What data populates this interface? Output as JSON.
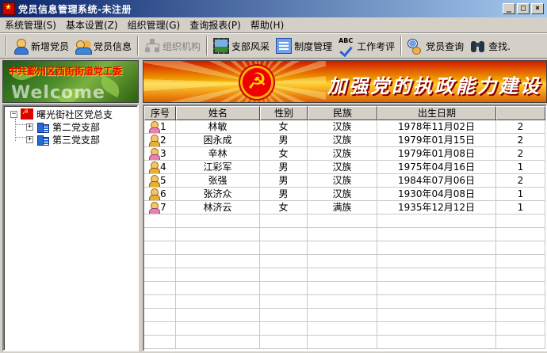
{
  "window": {
    "title": "党员信息管理系统-未注册",
    "buttons": {
      "minimize": "_",
      "maximize": "□",
      "close": "×"
    }
  },
  "menu": [
    {
      "label": "系统管理(S)"
    },
    {
      "label": "基本设置(Z)"
    },
    {
      "label": "组织管理(G)"
    },
    {
      "label": "查询报表(P)"
    },
    {
      "label": "帮助(H)"
    }
  ],
  "toolbar": {
    "add_member": "新增党员",
    "member_info": "党员信息",
    "org_structure": "组织机构",
    "branch_style": "支部风采",
    "regulations": "制度管理",
    "work_review": "工作考评",
    "member_query": "党员查询",
    "find": "查找."
  },
  "left_banner": {
    "title": "中共鄞州区西街街道党工委",
    "welcome": "Welcome"
  },
  "tree": {
    "root": "曙光街社区党总支",
    "children": [
      "第二党支部",
      "第三党支部"
    ]
  },
  "right_banner": {
    "slogan": "加强党的执政能力建设 与"
  },
  "table": {
    "columns": [
      "序号",
      "姓名",
      "性别",
      "民族",
      "出生日期",
      ""
    ],
    "rows": [
      {
        "id": "1",
        "name": "林敏",
        "gender": "女",
        "ethnicity": "汉族",
        "birth": "1978年11月02日",
        "extra": "2"
      },
      {
        "id": "2",
        "name": "困永成",
        "gender": "男",
        "ethnicity": "汉族",
        "birth": "1979年01月15日",
        "extra": "2"
      },
      {
        "id": "3",
        "name": "辛林",
        "gender": "女",
        "ethnicity": "汉族",
        "birth": "1979年01月08日",
        "extra": "2"
      },
      {
        "id": "4",
        "name": "江彩军",
        "gender": "男",
        "ethnicity": "汉族",
        "birth": "1975年04月16日",
        "extra": "1"
      },
      {
        "id": "5",
        "name": "张强",
        "gender": "男",
        "ethnicity": "汉族",
        "birth": "1984年07月06日",
        "extra": "2"
      },
      {
        "id": "6",
        "name": "张济众",
        "gender": "男",
        "ethnicity": "汉族",
        "birth": "1930年04月08日",
        "extra": "1"
      },
      {
        "id": "7",
        "name": "林济云",
        "gender": "女",
        "ethnicity": "满族",
        "birth": "1935年12月12日",
        "extra": "1"
      }
    ]
  },
  "colors": {
    "titlebar": "#0a246a",
    "banner_red": "#d21a00",
    "window_bg": "#d4d0c8"
  }
}
